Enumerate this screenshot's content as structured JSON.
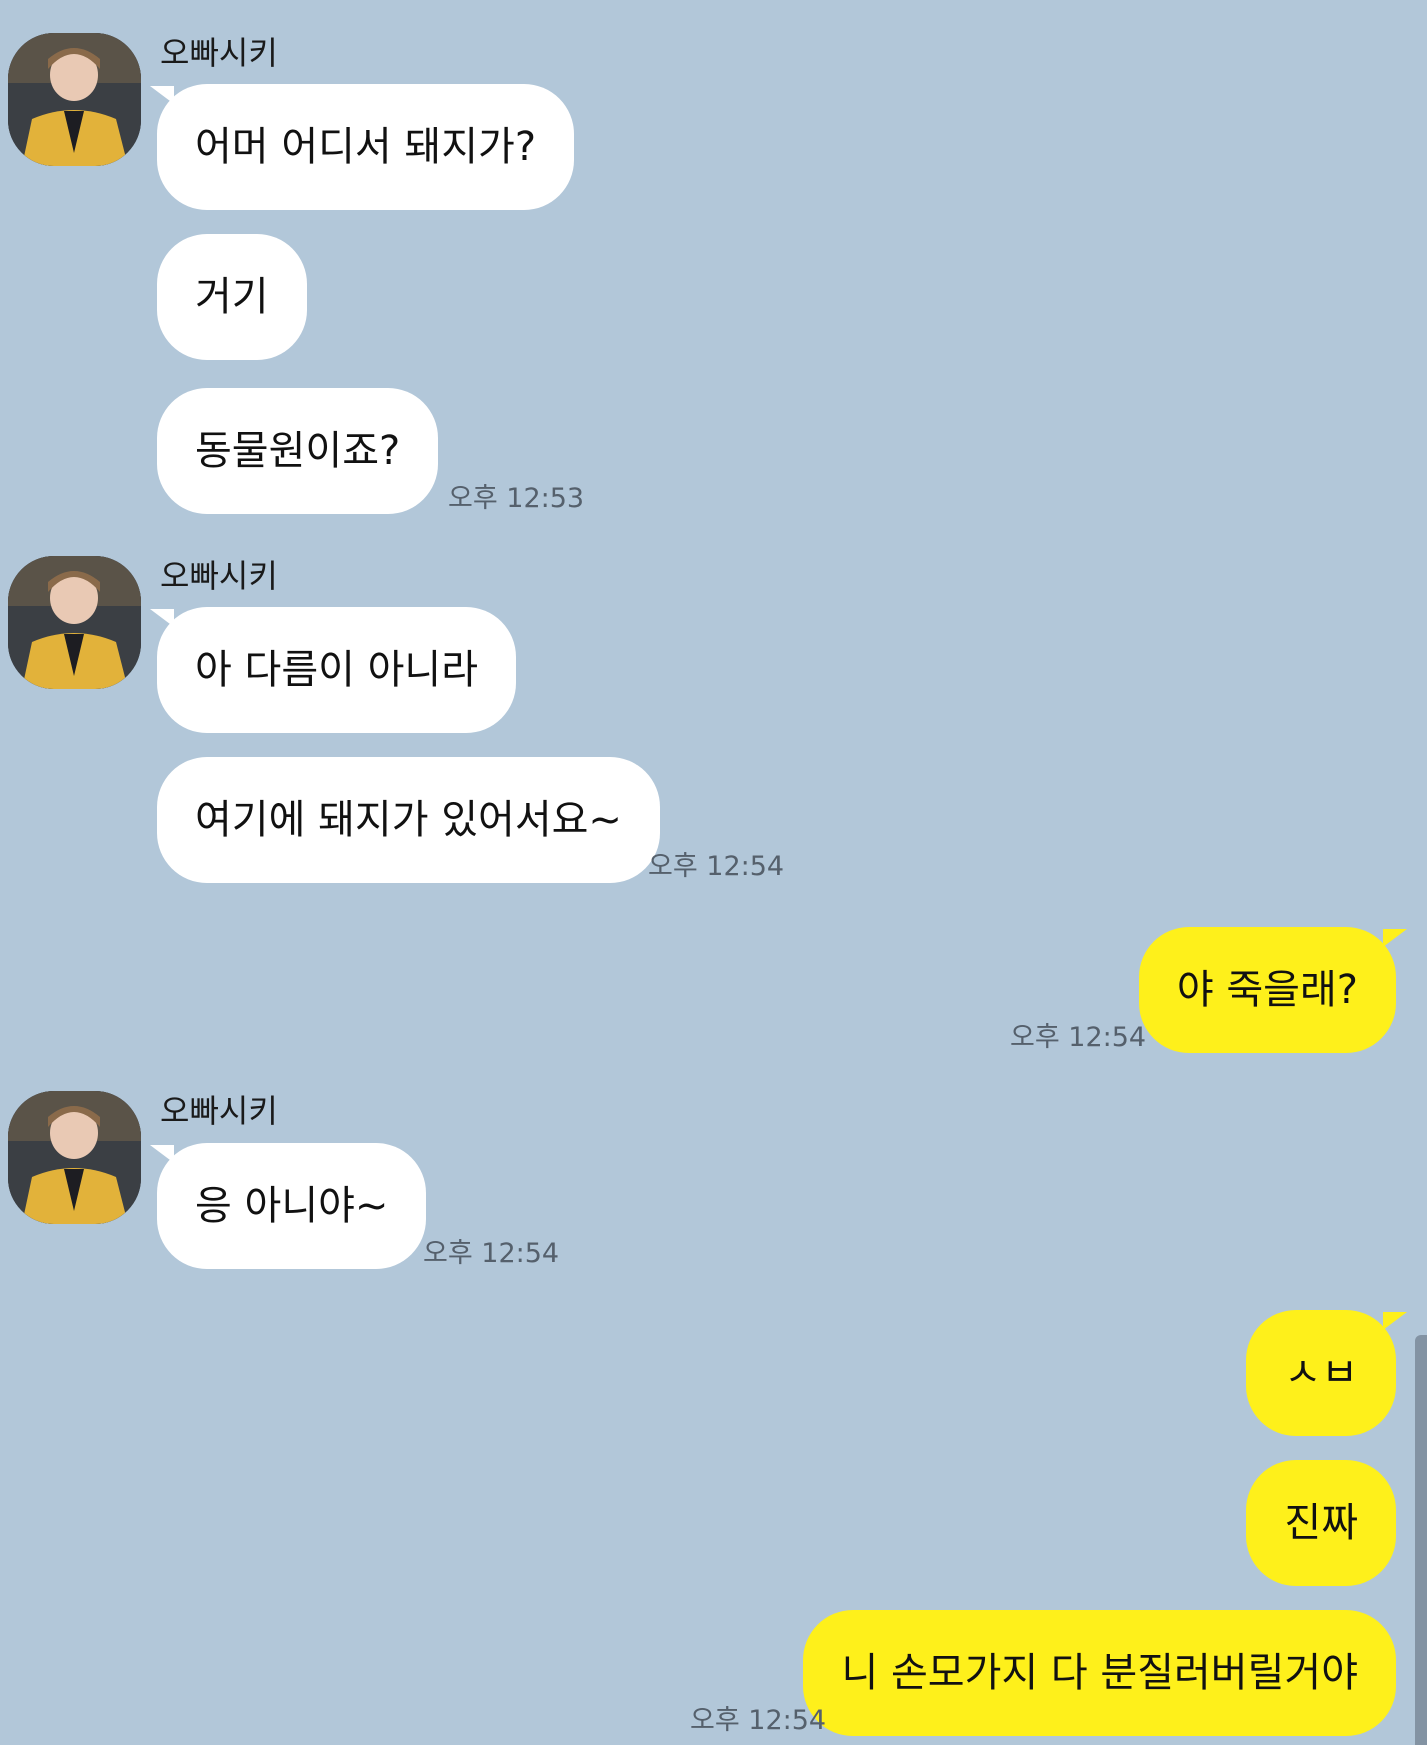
{
  "conversation": {
    "sender_name": "오빠시키",
    "groups": [
      {
        "side": "in",
        "messages": [
          "어머 어디서 돼지가?",
          "거기",
          "동물원이죠?"
        ],
        "time": "오후 12:53"
      },
      {
        "side": "in",
        "messages": [
          "아 다름이 아니라",
          "여기에 돼지가 있어서요~"
        ],
        "time": "오후 12:54"
      },
      {
        "side": "out",
        "messages": [
          "야 죽을래?"
        ],
        "time": "오후 12:54"
      },
      {
        "side": "in",
        "messages": [
          "응 아니야~"
        ],
        "time": "오후 12:54"
      },
      {
        "side": "out",
        "messages": [
          "ㅅㅂ",
          "진짜",
          "니 손모가지 다 분질러버릴거야"
        ],
        "time": "오후 12:54"
      }
    ]
  },
  "colors": {
    "background": "#b2c7d9",
    "incoming_bubble": "#ffffff",
    "outgoing_bubble": "#fef01b"
  },
  "icons": {
    "avatar": "profile-photo-avatar"
  }
}
